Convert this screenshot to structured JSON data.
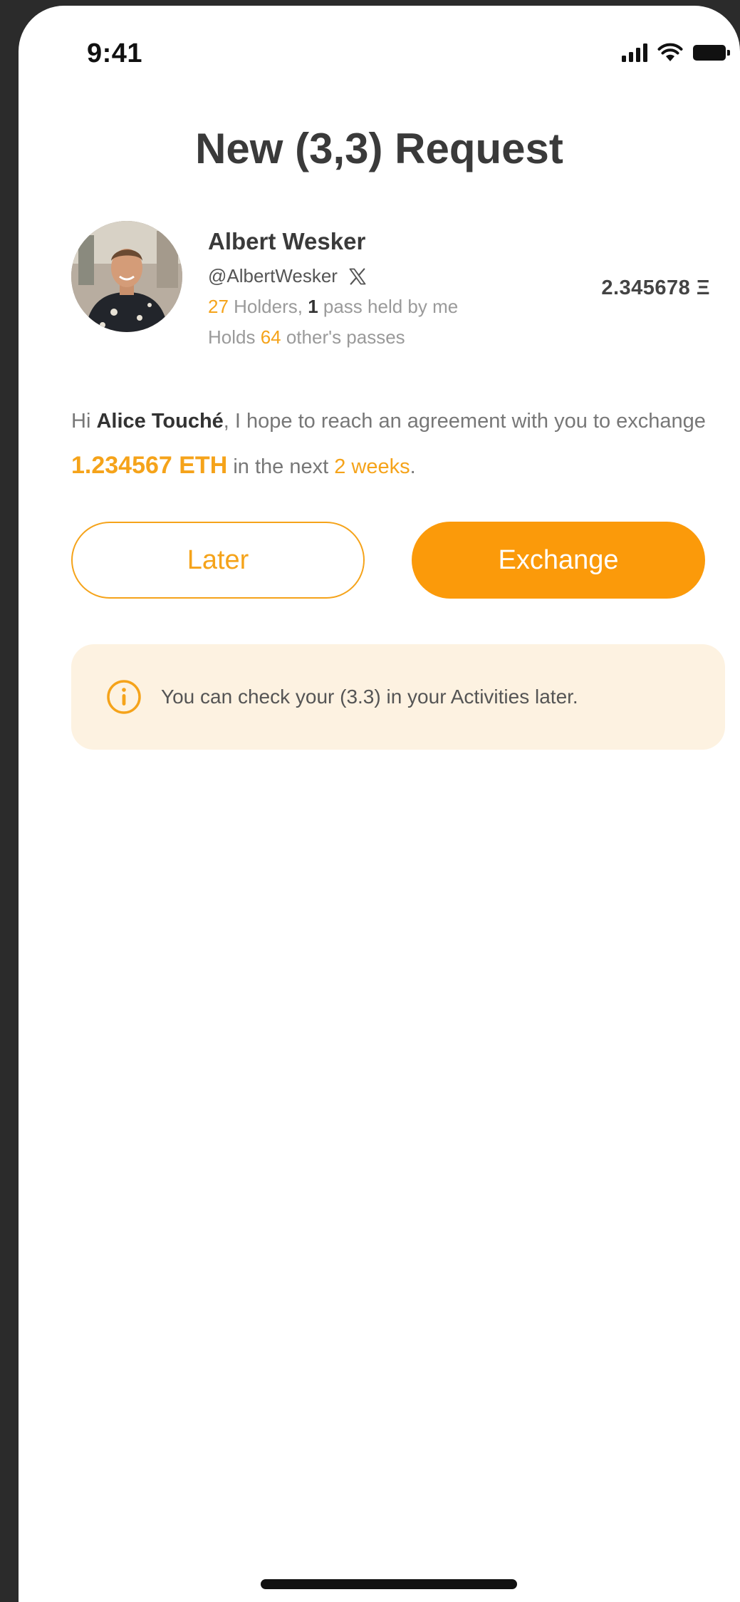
{
  "status_bar": {
    "time": "9:41"
  },
  "page_title": "New (3,3) Request",
  "profile": {
    "name": "Albert Wesker",
    "handle": "@AlbertWesker",
    "holders_count": "27",
    "holders_label": " Holders, ",
    "passes_held_count": "1",
    "passes_held_label": " pass held by me",
    "holds_prefix": "Holds ",
    "holds_count": "64",
    "holds_suffix": " other's passes",
    "balance": "2.345678 Ξ"
  },
  "message": {
    "greeting": "Hi ",
    "recipient": "Alice Touché",
    "text_1": ", I hope to reach an agreement with you to exchange ",
    "amount": "1.234567 ETH",
    "text_2": " in the next ",
    "period": "2 weeks",
    "text_3": "."
  },
  "buttons": {
    "later_label": "Later",
    "exchange_label": "Exchange"
  },
  "notice": {
    "text": "You can check your (3.3) in your Activities later."
  },
  "colors": {
    "accent": "#fb9a0a",
    "notice_bg": "#fdf2e1",
    "title": "#3a3a3a"
  },
  "icons": {
    "x": "x-logo-icon",
    "info": "info-icon",
    "signal": "cellular-signal-icon",
    "wifi": "wifi-icon",
    "battery": "battery-icon"
  }
}
